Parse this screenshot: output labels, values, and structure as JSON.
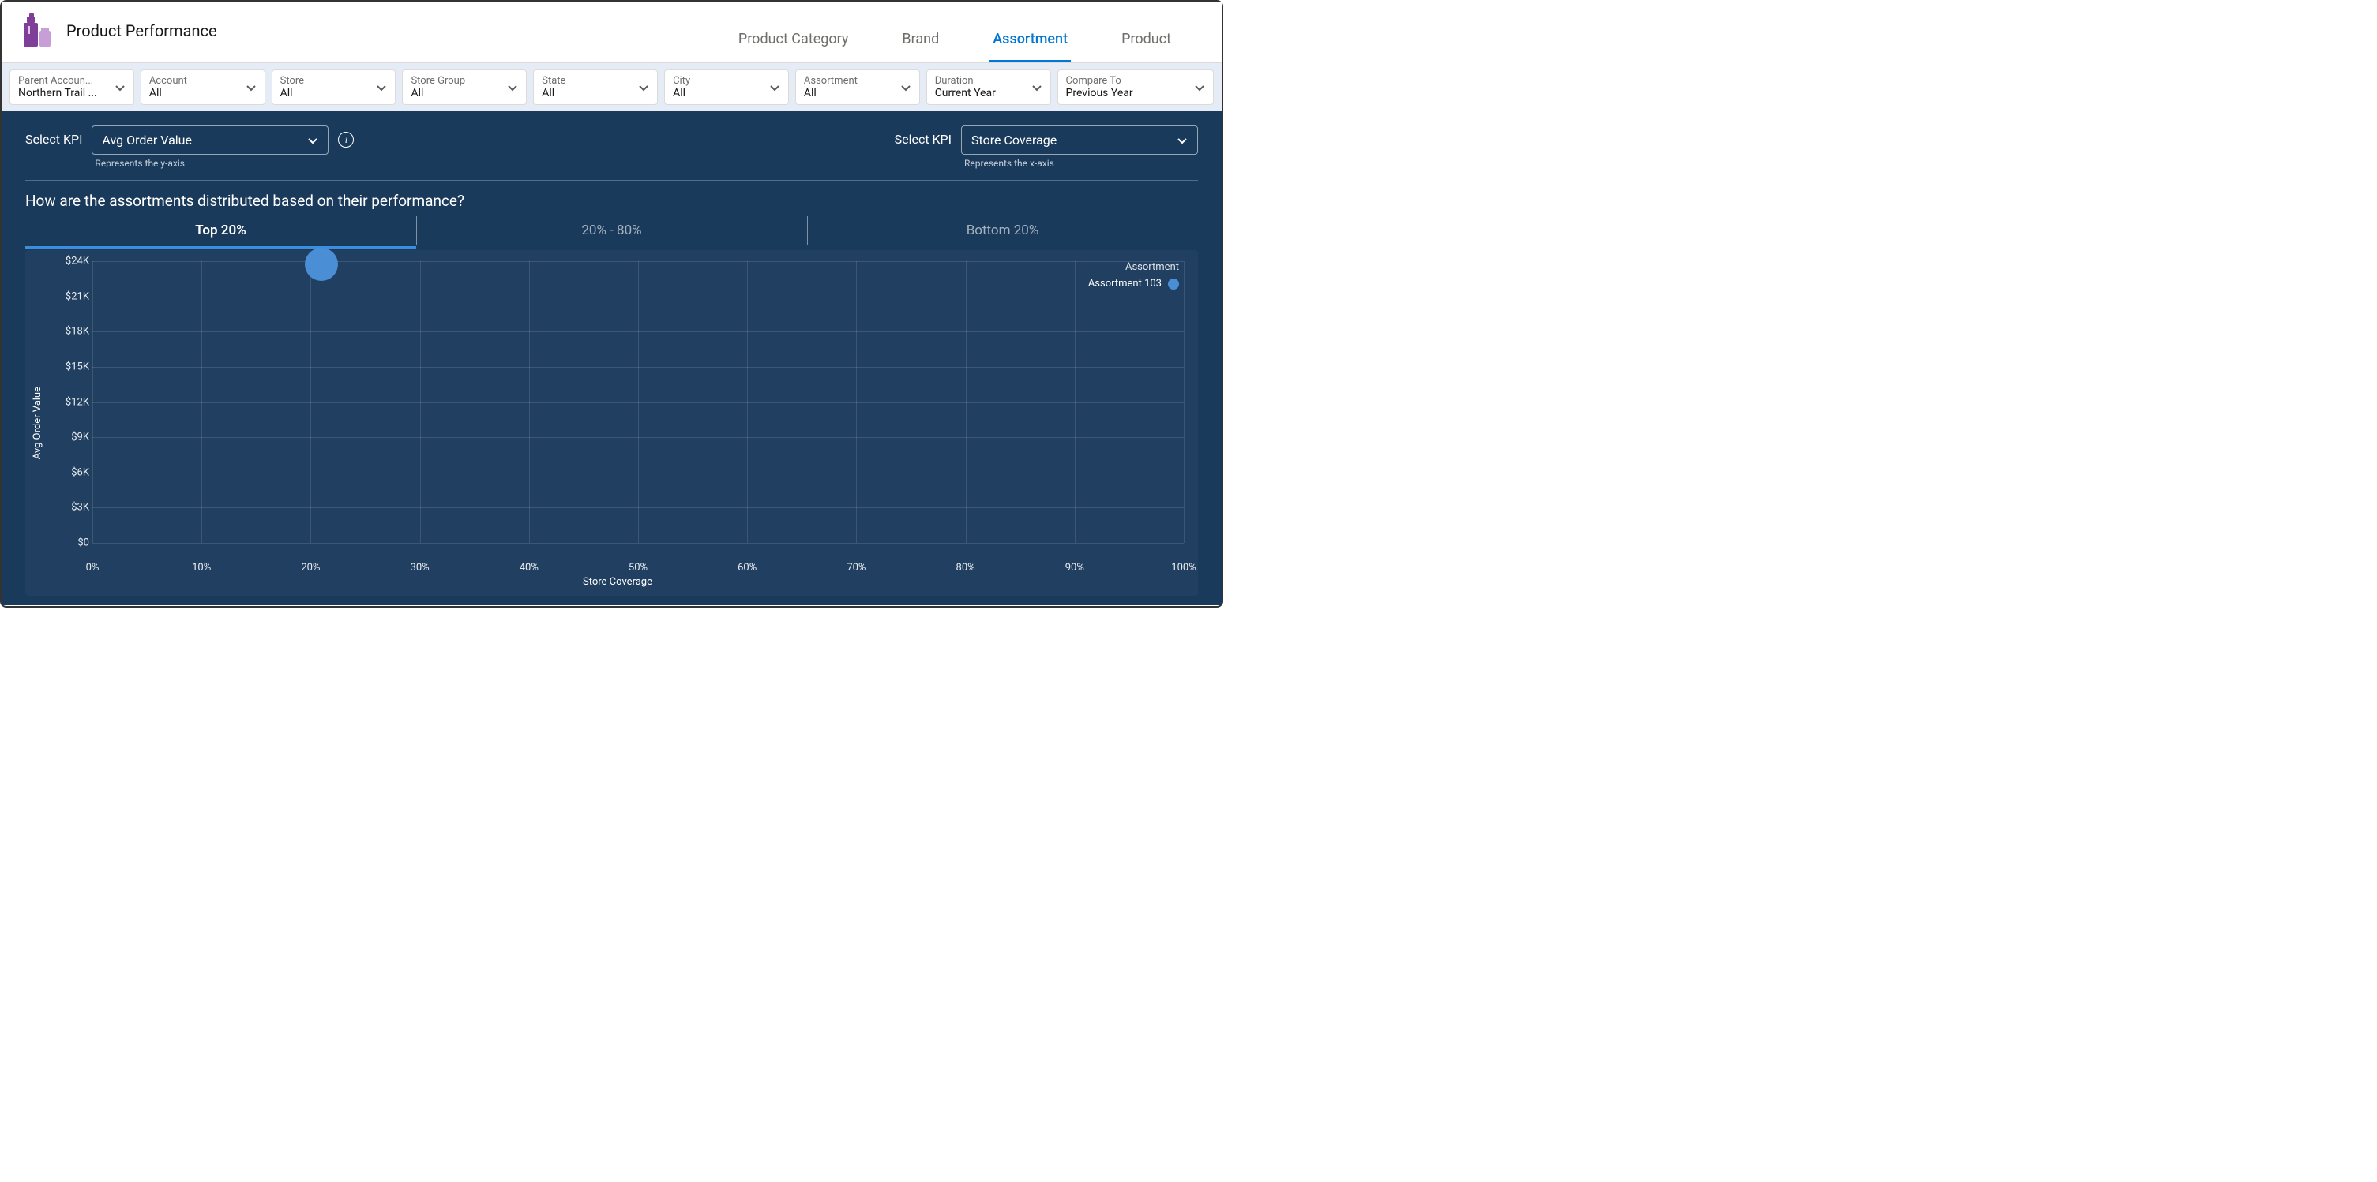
{
  "header": {
    "title": "Product Performance"
  },
  "tabs": [
    {
      "label": "Product Category",
      "active": false
    },
    {
      "label": "Brand",
      "active": false
    },
    {
      "label": "Assortment",
      "active": true
    },
    {
      "label": "Product",
      "active": false
    }
  ],
  "filters": [
    {
      "label": "Parent Accoun...",
      "value": "Northern Trail ..."
    },
    {
      "label": "Account",
      "value": "All"
    },
    {
      "label": "Store",
      "value": "All"
    },
    {
      "label": "Store Group",
      "value": "All"
    },
    {
      "label": "State",
      "value": "All"
    },
    {
      "label": "City",
      "value": "All"
    },
    {
      "label": "Assortment",
      "value": "All"
    },
    {
      "label": "Duration",
      "value": "Current Year"
    },
    {
      "label": "Compare To",
      "value": "Previous Year"
    }
  ],
  "kpi_left": {
    "label": "Select KPI",
    "value": "Avg Order Value",
    "hint": "Represents the y-axis"
  },
  "kpi_right": {
    "label": "Select KPI",
    "value": "Store Coverage",
    "hint": "Represents the x-axis"
  },
  "question": "How are the assortments distributed based on their performance?",
  "chart_tabs": [
    {
      "label": "Top 20%",
      "active": true
    },
    {
      "label": "20% - 80%",
      "active": false
    },
    {
      "label": "Bottom 20%",
      "active": false
    }
  ],
  "legend": {
    "title": "Assortment",
    "items": [
      {
        "label": "Assortment 103",
        "color": "#4a8fd6"
      }
    ]
  },
  "chart_data": {
    "type": "scatter",
    "title": "",
    "xlabel": "Store Coverage",
    "ylabel": "Avg Order Value",
    "xlim": [
      0,
      100
    ],
    "ylim": [
      0,
      24000
    ],
    "x_ticks": [
      0,
      10,
      20,
      30,
      40,
      50,
      60,
      70,
      80,
      90,
      100
    ],
    "x_tick_labels": [
      "0%",
      "10%",
      "20%",
      "30%",
      "40%",
      "50%",
      "60%",
      "70%",
      "80%",
      "90%",
      "100%"
    ],
    "y_ticks": [
      0,
      3000,
      6000,
      9000,
      12000,
      15000,
      18000,
      21000,
      24000
    ],
    "y_tick_labels": [
      "$0",
      "$3K",
      "$6K",
      "$9K",
      "$12K",
      "$15K",
      "$18K",
      "$21K",
      "$24K"
    ],
    "series": [
      {
        "name": "Assortment 103",
        "color": "#4a8fd6",
        "points": [
          {
            "x": 21,
            "y": 23700
          }
        ]
      }
    ]
  }
}
